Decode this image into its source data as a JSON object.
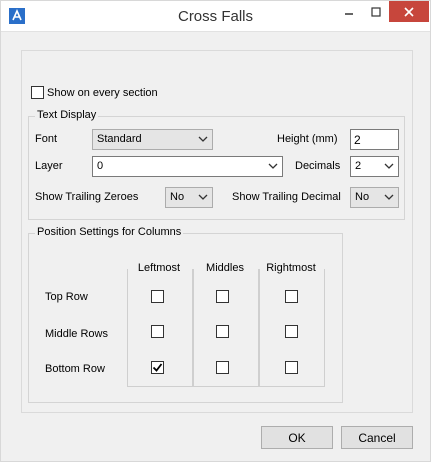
{
  "window": {
    "title": "Cross Falls"
  },
  "show_every_section": {
    "label": "Show on every section",
    "checked": false
  },
  "text_display": {
    "title": "Text Display",
    "font_label": "Font",
    "font_value": "Standard",
    "height_label": "Height (mm)",
    "height_value": "2",
    "layer_label": "Layer",
    "layer_value": "0",
    "decimals_label": "Decimals",
    "decimals_value": "2",
    "trailing_zeroes_label": "Show Trailing Zeroes",
    "trailing_zeroes_value": "No",
    "trailing_decimal_label": "Show Trailing Decimal",
    "trailing_decimal_value": "No"
  },
  "position": {
    "title": "Position Settings for Columns",
    "columns": [
      "Leftmost",
      "Middles",
      "Rightmost"
    ],
    "rows": [
      {
        "label": "Top Row",
        "checked": [
          false,
          false,
          false
        ]
      },
      {
        "label": "Middle Rows",
        "checked": [
          false,
          false,
          false
        ]
      },
      {
        "label": "Bottom Row",
        "checked": [
          true,
          false,
          false
        ]
      }
    ]
  },
  "buttons": {
    "ok": "OK",
    "cancel": "Cancel"
  }
}
